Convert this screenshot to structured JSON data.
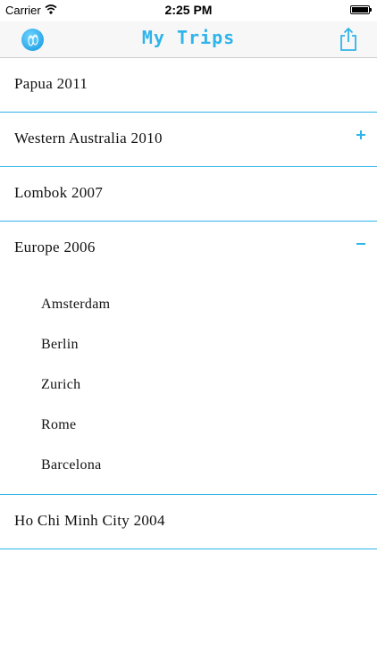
{
  "status_bar": {
    "carrier": "Carrier",
    "time": "2:25 PM"
  },
  "nav": {
    "title": "My Trips",
    "logo_icon": "flip-flops-icon",
    "share_icon": "share-icon",
    "accent_color": "#2fb4ea"
  },
  "trips": [
    {
      "title": "Papua 2011",
      "toggle": "none"
    },
    {
      "title": "Western Australia 2010",
      "toggle": "plus"
    },
    {
      "title": "Lombok 2007",
      "toggle": "none"
    },
    {
      "title": "Europe 2006",
      "toggle": "minus",
      "destinations": [
        "Amsterdam",
        "Berlin",
        "Zurich",
        "Rome",
        "Barcelona"
      ]
    },
    {
      "title": "Ho Chi Minh City 2004",
      "toggle": "none"
    }
  ]
}
